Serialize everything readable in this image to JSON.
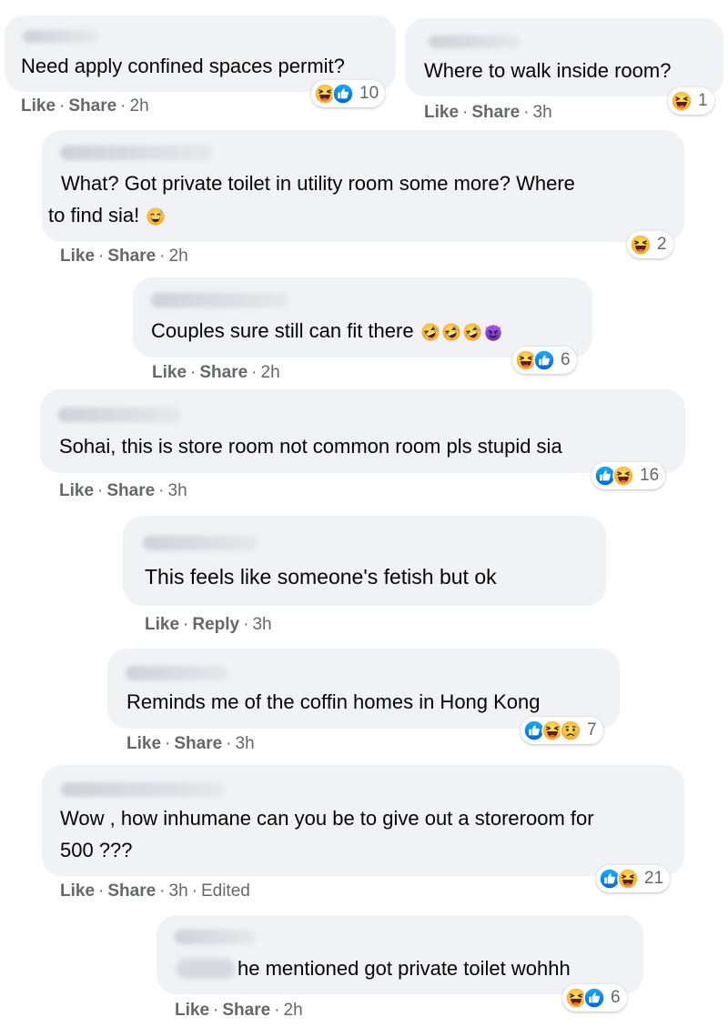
{
  "comments": [
    {
      "text": "Need apply confined spaces permit?",
      "like": "Like",
      "action": "Share",
      "time": "2h",
      "count": "10"
    },
    {
      "text": "Where to walk inside room?",
      "like": "Like",
      "action": "Share",
      "time": "3h",
      "count": "1"
    },
    {
      "text_line1": "What? Got private toilet in utility room some more? Where",
      "text_line2": "to find sia!",
      "like": "Like",
      "action": "Share",
      "time": "2h",
      "count": "2"
    },
    {
      "text": "Couples sure still can fit there",
      "like": "Like",
      "action": "Share",
      "time": "2h",
      "count": "6"
    },
    {
      "text": "Sohai, this is store room not common room pls stupid sia",
      "like": "Like",
      "action": "Share",
      "time": "3h",
      "count": "16"
    },
    {
      "text": "This feels like someone's fetish but ok",
      "like": "Like",
      "action": "Reply",
      "time": "3h"
    },
    {
      "text": "Reminds me of the coffin homes in Hong Kong",
      "like": "Like",
      "action": "Share",
      "time": "3h",
      "count": "7"
    },
    {
      "text_line1": "Wow , how inhumane can you be to give out a storeroom for",
      "text_line2": "500 ???",
      "like": "Like",
      "action": "Share",
      "time": "3h",
      "edited": "Edited",
      "count": "21"
    },
    {
      "text": "he mentioned got private toilet wohhh",
      "like": "Like",
      "action": "Share",
      "time": "2h",
      "count": "6"
    }
  ],
  "icons": {
    "like": "like-reaction-icon",
    "haha": "haha-reaction-icon",
    "sad": "sad-reaction-icon",
    "rofl": "rofl-emoji-icon",
    "devil": "devil-emoji-icon",
    "sweat_smile": "sweat-smile-emoji-icon"
  },
  "colors": {
    "bubble": "#f0f2f5",
    "meta": "#65676b",
    "like_blue": "#1877f2",
    "haha_yellow": "#f7b928"
  }
}
